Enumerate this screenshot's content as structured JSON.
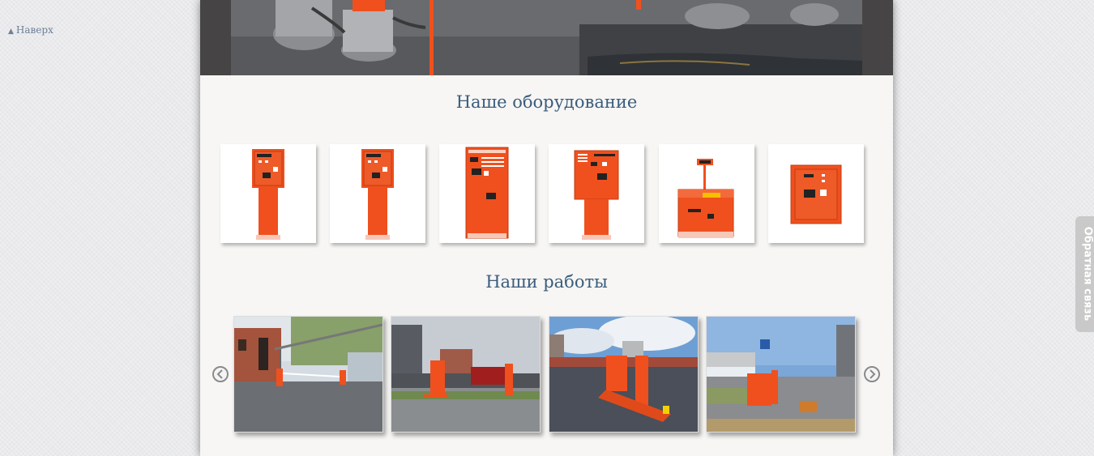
{
  "nav": {
    "to_top_label": "Наверх",
    "to_top_arrow": "▲"
  },
  "sections": {
    "equipment_title": "Наше оборудование",
    "works_title": "Наши работы"
  },
  "equipment": [
    {
      "item": "pay-terminal-stand-1"
    },
    {
      "item": "pay-terminal-stand-2"
    },
    {
      "item": "pay-terminal-cabinet"
    },
    {
      "item": "pay-terminal-stand-3"
    },
    {
      "item": "desk-terminal"
    },
    {
      "item": "wall-terminal"
    }
  ],
  "works": [
    {
      "item": "parking-gate-1"
    },
    {
      "item": "parking-gate-2"
    },
    {
      "item": "parking-gate-3"
    },
    {
      "item": "parking-gate-4"
    }
  ],
  "carousel": {
    "prev_icon": "chevron-left-icon",
    "next_icon": "chevron-right-icon"
  },
  "feedback": {
    "label": "Обратная связь"
  },
  "colors": {
    "accent_orange": "#f0501e",
    "title_blue": "#3b5d7c",
    "page_bg": "#f7f6f4",
    "feedback_bg": "#c9c9c9"
  }
}
